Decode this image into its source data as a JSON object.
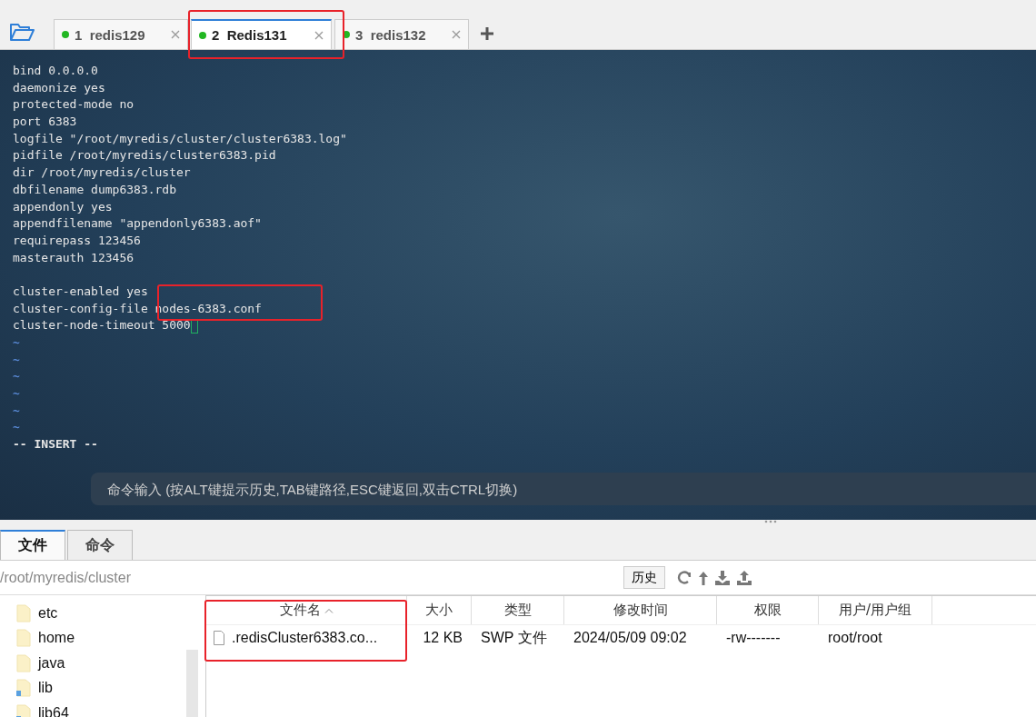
{
  "tabs": [
    {
      "number": "1",
      "label": "redis129",
      "selected": false
    },
    {
      "number": "2",
      "label": "Redis131",
      "selected": true
    },
    {
      "number": "3",
      "label": "redis132",
      "selected": false
    }
  ],
  "terminal": {
    "lines": [
      {
        "kind": "text",
        "text": "bind 0.0.0.0"
      },
      {
        "kind": "text",
        "text": "daemonize yes"
      },
      {
        "kind": "text",
        "text": "protected-mode no"
      },
      {
        "kind": "text",
        "text": "port 6383"
      },
      {
        "kind": "text",
        "text": "logfile \"/root/myredis/cluster/cluster6383.log\""
      },
      {
        "kind": "text",
        "text": "pidfile /root/myredis/cluster6383.pid"
      },
      {
        "kind": "text",
        "text": "dir /root/myredis/cluster"
      },
      {
        "kind": "text",
        "text": "dbfilename dump6383.rdb"
      },
      {
        "kind": "text",
        "text": "appendonly yes"
      },
      {
        "kind": "text",
        "text": "appendfilename \"appendonly6383.aof\""
      },
      {
        "kind": "text",
        "text": "requirepass 123456"
      },
      {
        "kind": "text",
        "text": "masterauth 123456"
      },
      {
        "kind": "blank"
      },
      {
        "kind": "text",
        "text": "cluster-enabled yes"
      },
      {
        "kind": "text",
        "text": "cluster-config-file nodes-6383.conf"
      },
      {
        "kind": "cursor",
        "text": "cluster-node-timeout 5000"
      },
      {
        "kind": "tilde",
        "text": "~"
      },
      {
        "kind": "tilde",
        "text": "~"
      },
      {
        "kind": "tilde",
        "text": "~"
      },
      {
        "kind": "tilde",
        "text": "~"
      },
      {
        "kind": "tilde",
        "text": "~"
      },
      {
        "kind": "tilde",
        "text": "~"
      },
      {
        "kind": "mode",
        "text": "-- INSERT --"
      }
    ],
    "command_input": {
      "placeholder": "命令输入 (按ALT键提示历史,TAB键路径,ESC键返回,双击CTRL切换)"
    }
  },
  "panel_tabs": [
    {
      "label": "文件",
      "selected": true
    },
    {
      "label": "命令",
      "selected": false
    }
  ],
  "path": "/root/myredis/cluster",
  "history_button": "历史",
  "tree": [
    {
      "kind": "folder",
      "name": "etc"
    },
    {
      "kind": "folder",
      "name": "home"
    },
    {
      "kind": "folder",
      "name": "java"
    },
    {
      "kind": "link",
      "name": "lib"
    },
    {
      "kind": "link",
      "name": "lib64"
    }
  ],
  "table": {
    "columns": [
      {
        "label": "文件名",
        "sorted": true
      },
      {
        "label": "大小",
        "sorted": false
      },
      {
        "label": "类型",
        "sorted": false
      },
      {
        "label": "修改时间",
        "sorted": false
      },
      {
        "label": "权限",
        "sorted": false
      },
      {
        "label": "用户/用户组",
        "sorted": false
      }
    ],
    "rows": [
      [
        ".redisCluster6383.co...",
        "12 KB",
        "SWP 文件",
        "2024/05/09 09:02",
        "-rw-------",
        "root/root"
      ]
    ]
  }
}
